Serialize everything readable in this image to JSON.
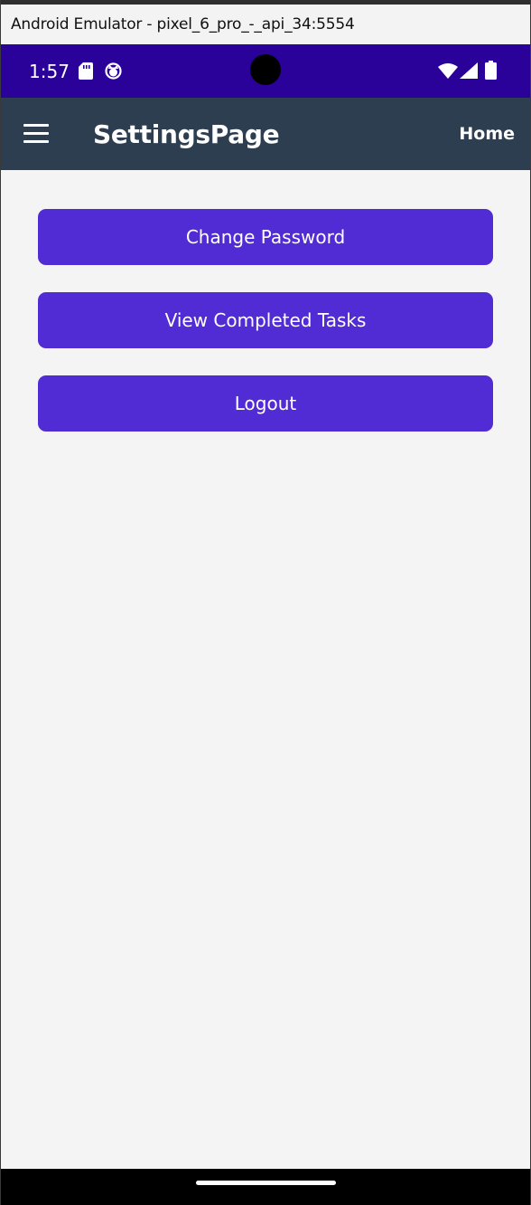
{
  "window": {
    "title": "Android Emulator - pixel_6_pro_-_api_34:5554"
  },
  "status_bar": {
    "time": "1:57",
    "icons": [
      "sd-card-icon",
      "cat-notification-icon",
      "camera-cutout",
      "wifi-icon",
      "cell-signal-icon",
      "battery-icon"
    ],
    "background_color": "#2a0299"
  },
  "app_bar": {
    "menu_icon": "hamburger-menu-icon",
    "title": "SettingsPage",
    "home_label": "Home",
    "background_color": "#2c3e50"
  },
  "main": {
    "buttons": [
      {
        "label": "Change Password"
      },
      {
        "label": "View Completed Tasks"
      },
      {
        "label": "Logout"
      }
    ],
    "button_color": "#512bd4"
  },
  "nav_bar": {
    "gesture_handle": "home-gesture-pill"
  }
}
